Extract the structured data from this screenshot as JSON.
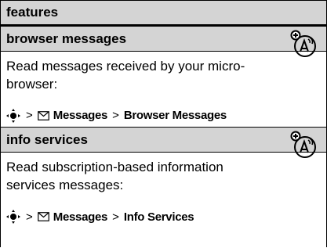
{
  "header": {
    "title": "features"
  },
  "sections": [
    {
      "title": "browser messages",
      "icon": "network-antenna-icon",
      "description": "Read messages received by your micro-browser:",
      "path": {
        "gt1": ">",
        "item1": "Messages",
        "gt2": ">",
        "item2": "Browser Messages"
      }
    },
    {
      "title": "info services",
      "icon": "network-antenna-icon",
      "description": "Read subscription-based information services messages:",
      "path": {
        "gt1": ">",
        "item1": "Messages",
        "gt2": ">",
        "item2": "Info Services"
      }
    }
  ]
}
